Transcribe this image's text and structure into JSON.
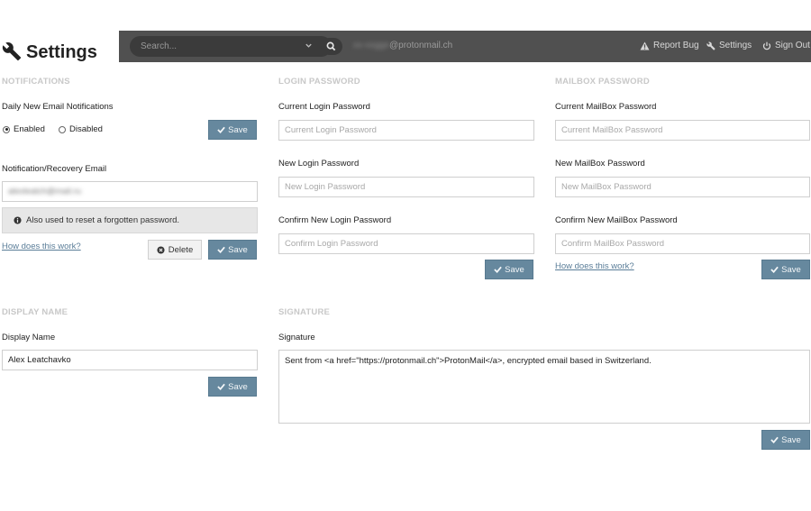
{
  "header": {
    "title": "Settings",
    "search_placeholder": "Search...",
    "email_redacted": "xx-xxgge",
    "email_domain": "@protonmail.ch",
    "links": {
      "report_bug": "Report Bug",
      "settings": "Settings",
      "sign_out": "Sign Out"
    }
  },
  "notifications": {
    "title": "NOTIFICATIONS",
    "daily_label": "Daily New Email Notifications",
    "enabled_label": "Enabled",
    "disabled_label": "Disabled",
    "selected": "enabled",
    "save_label": "Save",
    "recovery_label": "Notification/Recovery Email",
    "recovery_value_redacted": "alexleatch@mail.ru",
    "info_text": "Also used to reset a forgotten password.",
    "help_link": "How does this work?",
    "delete_label": "Delete",
    "save2_label": "Save"
  },
  "login_password": {
    "title": "LOGIN PASSWORD",
    "current_label": "Current Login Password",
    "current_placeholder": "Current Login Password",
    "new_label": "New Login Password",
    "new_placeholder": "New Login Password",
    "confirm_label": "Confirm New Login Password",
    "confirm_placeholder": "Confirm Login Password",
    "save_label": "Save"
  },
  "mailbox_password": {
    "title": "MAILBOX PASSWORD",
    "current_label": "Current MailBox Password",
    "current_placeholder": "Current MailBox Password",
    "new_label": "New MailBox Password",
    "new_placeholder": "New MailBox Password",
    "confirm_label": "Confirm New MailBox Password",
    "confirm_placeholder": "Confirm MailBox Password",
    "help_link": "How does this work?",
    "save_label": "Save"
  },
  "display_name": {
    "title": "DISPLAY NAME",
    "label": "Display Name",
    "value": "Alex Leatchavko",
    "save_label": "Save"
  },
  "signature": {
    "title": "SIGNATURE",
    "label": "Signature",
    "value": "Sent from <a href=\"https://protonmail.ch\">ProtonMail</a>, encrypted email based in Switzerland.",
    "save_label": "Save"
  },
  "colors": {
    "topbar": "#505050",
    "save_button": "#66889e",
    "link": "#5a7d98",
    "section_title": "#c8c8c8"
  },
  "icons": [
    "wrench-icon",
    "search-icon",
    "chevron-down-icon",
    "warning-icon",
    "power-icon",
    "check-icon",
    "info-icon",
    "times-circle-icon"
  ]
}
